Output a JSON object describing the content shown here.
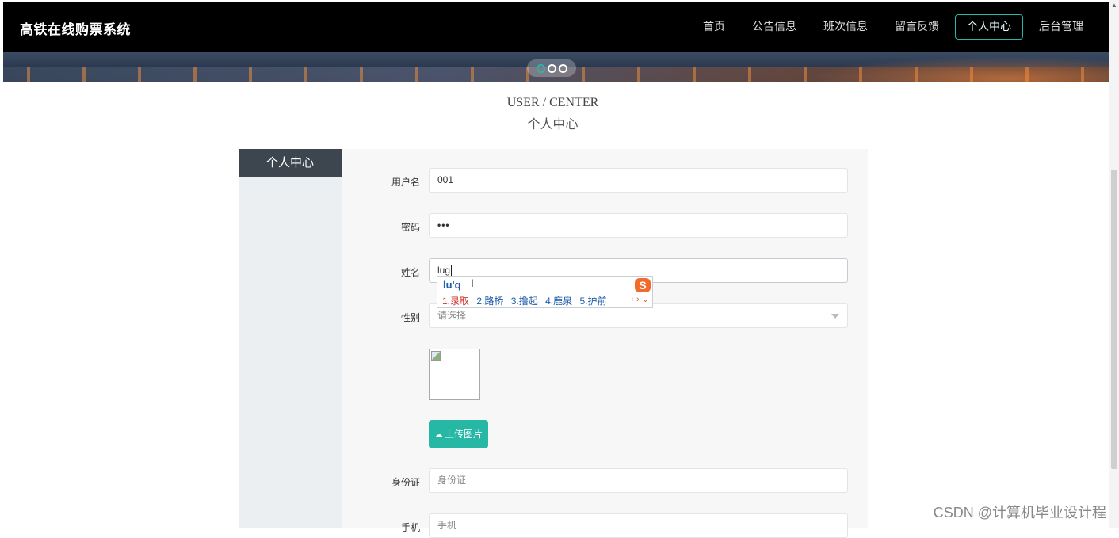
{
  "brand": "高铁在线购票系统",
  "nav": {
    "items": [
      {
        "label": "首页"
      },
      {
        "label": "公告信息"
      },
      {
        "label": "班次信息"
      },
      {
        "label": "留言反馈"
      },
      {
        "label": "个人中心",
        "active": true
      },
      {
        "label": "后台管理"
      }
    ]
  },
  "carousel": {
    "dots": 3,
    "active_index": 0
  },
  "section": {
    "title_en": "USER / CENTER",
    "title_cn": "个人中心"
  },
  "sidebar": {
    "title": "个人中心"
  },
  "form": {
    "username": {
      "label": "用户名",
      "value": "001"
    },
    "password": {
      "label": "密码",
      "value": "•••"
    },
    "name": {
      "label": "姓名",
      "value": "lug"
    },
    "gender": {
      "label": "性别",
      "placeholder": "请选择"
    },
    "upload_label": "上传图片",
    "id_card": {
      "label": "身份证",
      "placeholder": "身份证"
    },
    "phone": {
      "label": "手机",
      "placeholder": "手机"
    }
  },
  "ime": {
    "composition": "lu'q",
    "candidates": [
      "1.录取",
      "2.路桥",
      "3.撸起",
      "4.鹿泉",
      "5.护前"
    ]
  },
  "watermark": "CSDN @计算机毕业设计程",
  "colors": {
    "accent": "#26b7a5",
    "topbar": "#000000",
    "sidebar_head": "#3d464f"
  }
}
